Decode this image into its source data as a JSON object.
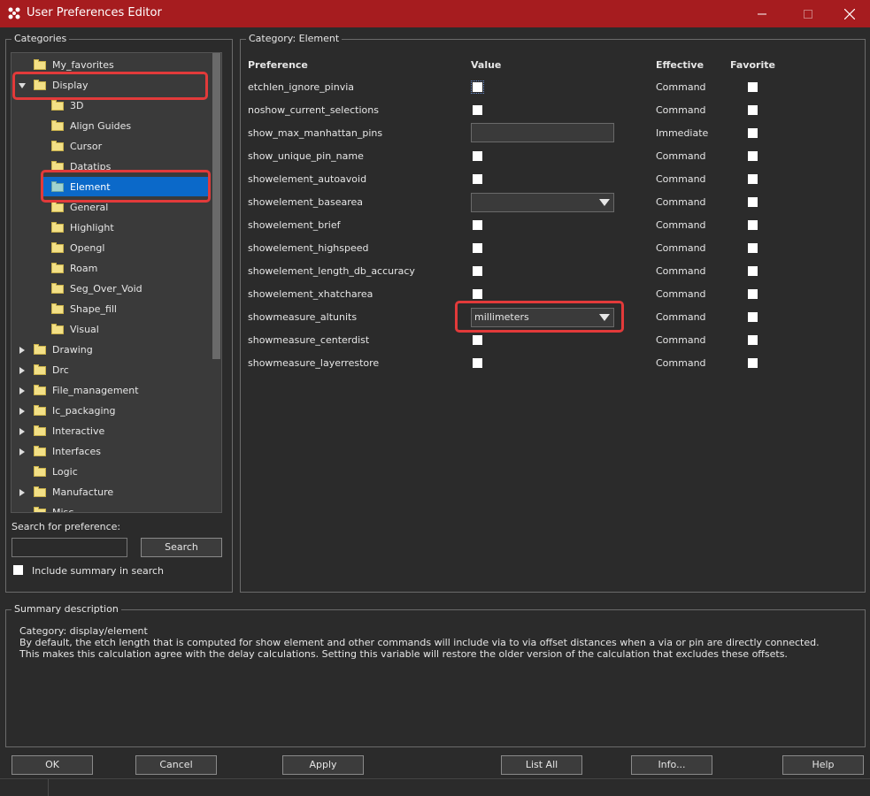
{
  "window": {
    "title": "User Preferences Editor",
    "accent_color": "#a61c1f"
  },
  "categories_panel": {
    "label": "Categories",
    "items": [
      {
        "label": "My_favorites",
        "expander": "none",
        "level": 0
      },
      {
        "label": "Display",
        "expander": "expanded",
        "level": 0
      },
      {
        "label": "3D",
        "expander": "none",
        "level": 1
      },
      {
        "label": "Align Guides",
        "expander": "none",
        "level": 1
      },
      {
        "label": "Cursor",
        "expander": "none",
        "level": 1
      },
      {
        "label": "Datatips",
        "expander": "none",
        "level": 1
      },
      {
        "label": "Element",
        "expander": "none",
        "level": 1,
        "selected": true
      },
      {
        "label": "General",
        "expander": "none",
        "level": 1
      },
      {
        "label": "Highlight",
        "expander": "none",
        "level": 1
      },
      {
        "label": "Opengl",
        "expander": "none",
        "level": 1
      },
      {
        "label": "Roam",
        "expander": "none",
        "level": 1
      },
      {
        "label": "Seg_Over_Void",
        "expander": "none",
        "level": 1
      },
      {
        "label": "Shape_fill",
        "expander": "none",
        "level": 1
      },
      {
        "label": "Visual",
        "expander": "none",
        "level": 1
      },
      {
        "label": "Drawing",
        "expander": "collapsed",
        "level": 0
      },
      {
        "label": "Drc",
        "expander": "collapsed",
        "level": 0
      },
      {
        "label": "File_management",
        "expander": "collapsed",
        "level": 0
      },
      {
        "label": "Ic_packaging",
        "expander": "collapsed",
        "level": 0
      },
      {
        "label": "Interactive",
        "expander": "collapsed",
        "level": 0
      },
      {
        "label": "Interfaces",
        "expander": "collapsed",
        "level": 0
      },
      {
        "label": "Logic",
        "expander": "none",
        "level": 0
      },
      {
        "label": "Manufacture",
        "expander": "collapsed",
        "level": 0
      },
      {
        "label": "Misc",
        "expander": "none",
        "level": 0
      }
    ],
    "search_label": "Search for preference:",
    "search_value": "",
    "search_button": "Search",
    "include_summary_label": "Include summary in search",
    "include_summary_checked": false
  },
  "preferences_panel": {
    "category_label": "Category:  Element",
    "columns": {
      "preference": "Preference",
      "value": "Value",
      "effective": "Effective",
      "favorite": "Favorite"
    },
    "rows": [
      {
        "name": "etchlen_ignore_pinvia",
        "value_type": "checkbox",
        "checked": false,
        "effective": "Command",
        "favorite": false
      },
      {
        "name": "noshow_current_selections",
        "value_type": "checkbox",
        "checked": false,
        "effective": "Command",
        "favorite": false
      },
      {
        "name": "show_max_manhattan_pins",
        "value_type": "text",
        "value": "",
        "effective": "Immediate",
        "favorite": false
      },
      {
        "name": "show_unique_pin_name",
        "value_type": "checkbox",
        "checked": false,
        "effective": "Command",
        "favorite": false
      },
      {
        "name": "showelement_autoavoid",
        "value_type": "checkbox",
        "checked": false,
        "effective": "Command",
        "favorite": false
      },
      {
        "name": "showelement_basearea",
        "value_type": "select",
        "value": "",
        "effective": "Command",
        "favorite": false
      },
      {
        "name": "showelement_brief",
        "value_type": "checkbox",
        "checked": false,
        "effective": "Command",
        "favorite": false
      },
      {
        "name": "showelement_highspeed",
        "value_type": "checkbox",
        "checked": false,
        "effective": "Command",
        "favorite": false
      },
      {
        "name": "showelement_length_db_accuracy",
        "value_type": "checkbox",
        "checked": false,
        "effective": "Command",
        "favorite": false
      },
      {
        "name": "showelement_xhatcharea",
        "value_type": "checkbox",
        "checked": false,
        "effective": "Command",
        "favorite": false
      },
      {
        "name": "showmeasure_altunits",
        "value_type": "select",
        "value": "millimeters",
        "effective": "Command",
        "favorite": false
      },
      {
        "name": "showmeasure_centerdist",
        "value_type": "checkbox",
        "checked": false,
        "effective": "Command",
        "favorite": false
      },
      {
        "name": "showmeasure_layerrestore",
        "value_type": "checkbox",
        "checked": false,
        "effective": "Command",
        "favorite": false
      }
    ]
  },
  "summary": {
    "label": "Summary description",
    "category_line": "Category: display/element",
    "text": "By default, the etch length that is computed for show element and other commands will include via to via offset distances when a via or pin are directly connected. This makes this calculation agree with the delay calculations. Setting this variable will restore the older version of the calculation that excludes these offsets."
  },
  "buttons": {
    "ok": "OK",
    "cancel": "Cancel",
    "apply": "Apply",
    "list_all": "List All",
    "info": "Info...",
    "help": "Help"
  },
  "highlight_color": "#e23a3a",
  "selection_color": "#0b69c9"
}
